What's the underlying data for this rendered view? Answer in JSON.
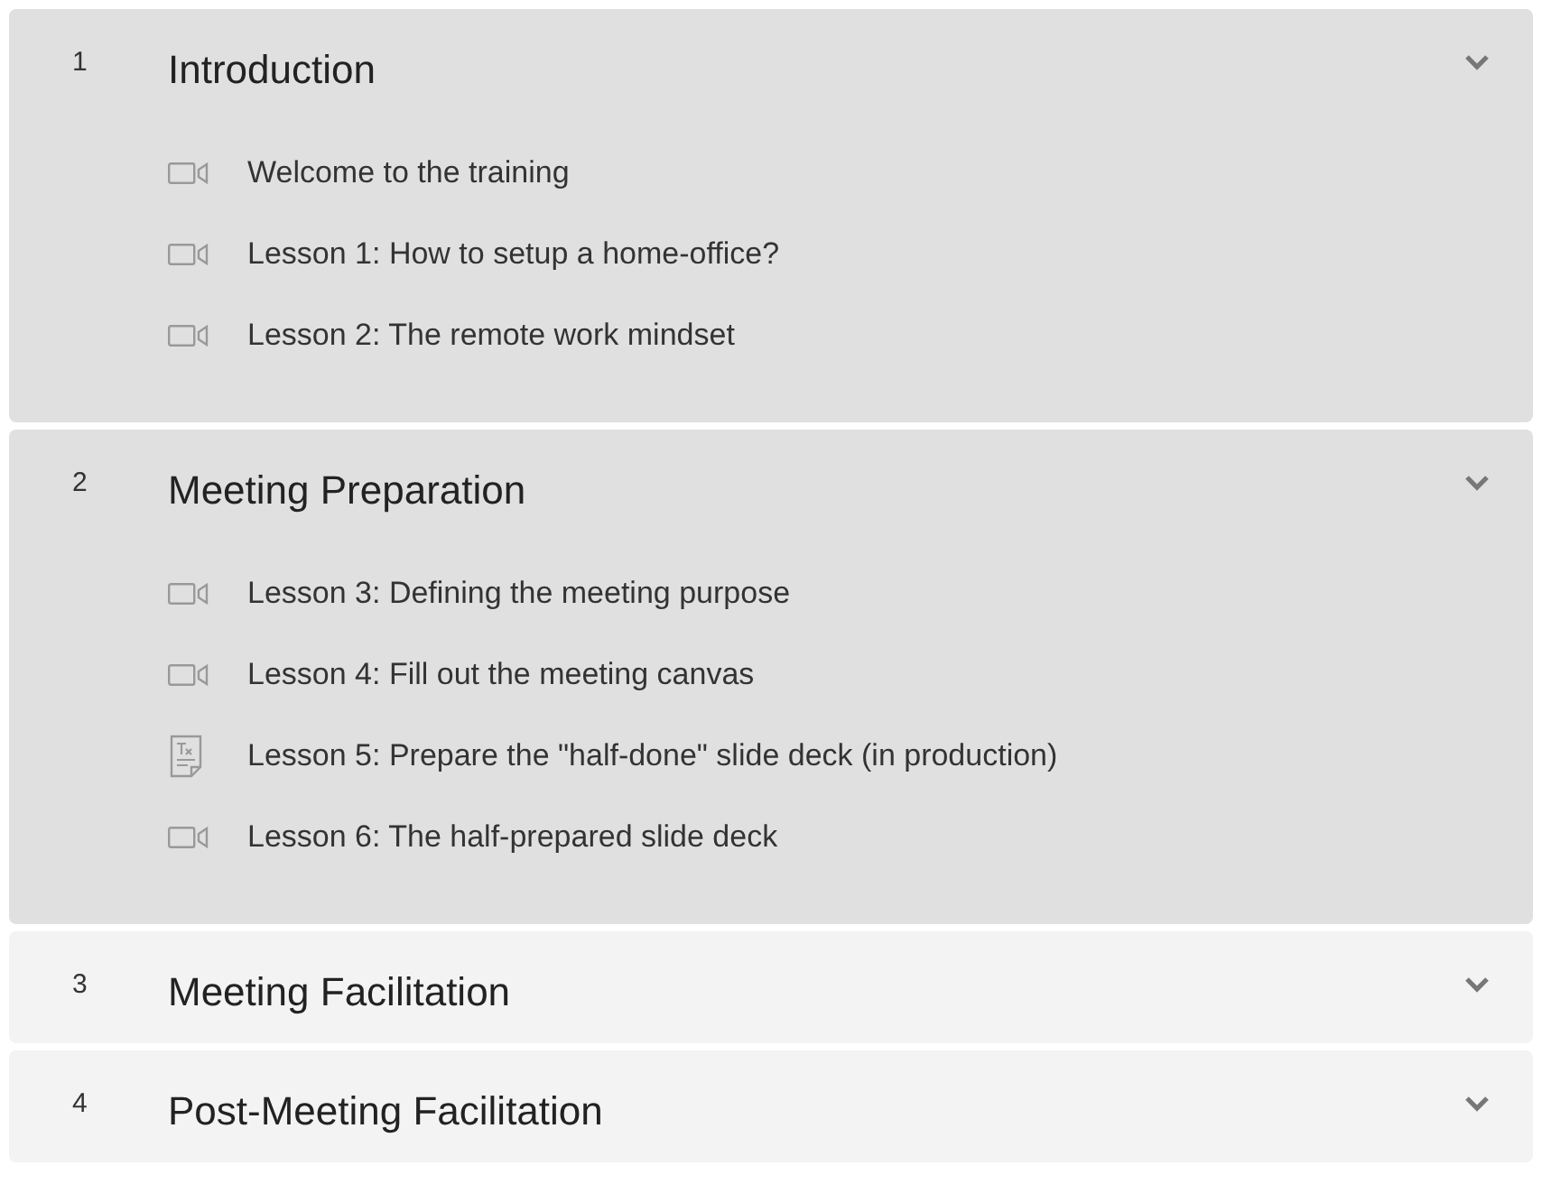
{
  "sections": [
    {
      "number": "1",
      "title": "Introduction",
      "expanded": true,
      "lessons": [
        {
          "kind": "video",
          "title": "Welcome to the training"
        },
        {
          "kind": "video",
          "title": "Lesson 1: How to setup a home-office?"
        },
        {
          "kind": "video",
          "title": "Lesson 2: The remote work mindset"
        }
      ]
    },
    {
      "number": "2",
      "title": "Meeting Preparation",
      "expanded": true,
      "lessons": [
        {
          "kind": "video",
          "title": "Lesson 3: Defining the meeting purpose"
        },
        {
          "kind": "video",
          "title": "Lesson 4: Fill out the meeting canvas"
        },
        {
          "kind": "text",
          "title": "Lesson 5: Prepare the \"half-done\" slide deck (in production)"
        },
        {
          "kind": "video",
          "title": "Lesson 6: The half-prepared slide deck"
        }
      ]
    },
    {
      "number": "3",
      "title": "Meeting Facilitation",
      "expanded": false
    },
    {
      "number": "4",
      "title": "Post-Meeting Facilitation",
      "expanded": false
    }
  ]
}
